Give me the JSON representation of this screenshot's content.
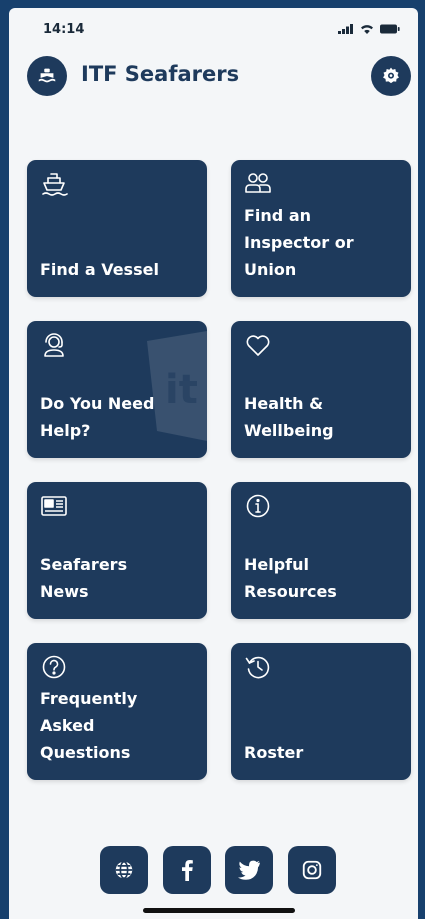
{
  "status_bar": {
    "time": "14:14",
    "icons": [
      "signal-icon",
      "wifi-icon",
      "battery-icon"
    ]
  },
  "header": {
    "title": "ITF Seafarers",
    "logo_icon": "ship-icon",
    "settings_icon": "gear-icon"
  },
  "tiles": [
    {
      "label": "Find a Vessel",
      "icon": "ship-icon"
    },
    {
      "label": "Find an\nInspector or\nUnion",
      "icon": "people-icon"
    },
    {
      "label": "Do You Need\nHelp?",
      "icon": "headset-icon"
    },
    {
      "label": "Health &\nWellbeing",
      "icon": "heart-icon"
    },
    {
      "label": "Seafarers\nNews",
      "icon": "newspaper-icon"
    },
    {
      "label": "Helpful\nResources",
      "icon": "info-icon"
    },
    {
      "label": "Frequently\nAsked\nQuestions",
      "icon": "question-icon"
    },
    {
      "label": "Roster",
      "icon": "history-icon"
    }
  ],
  "social": [
    "globe-icon",
    "facebook-icon",
    "twitter-icon",
    "instagram-icon"
  ],
  "colors": {
    "brand": "#1e3a5c",
    "frame": "#17406d",
    "background": "#f4f6f8",
    "text_on_tile": "#ffffff"
  }
}
